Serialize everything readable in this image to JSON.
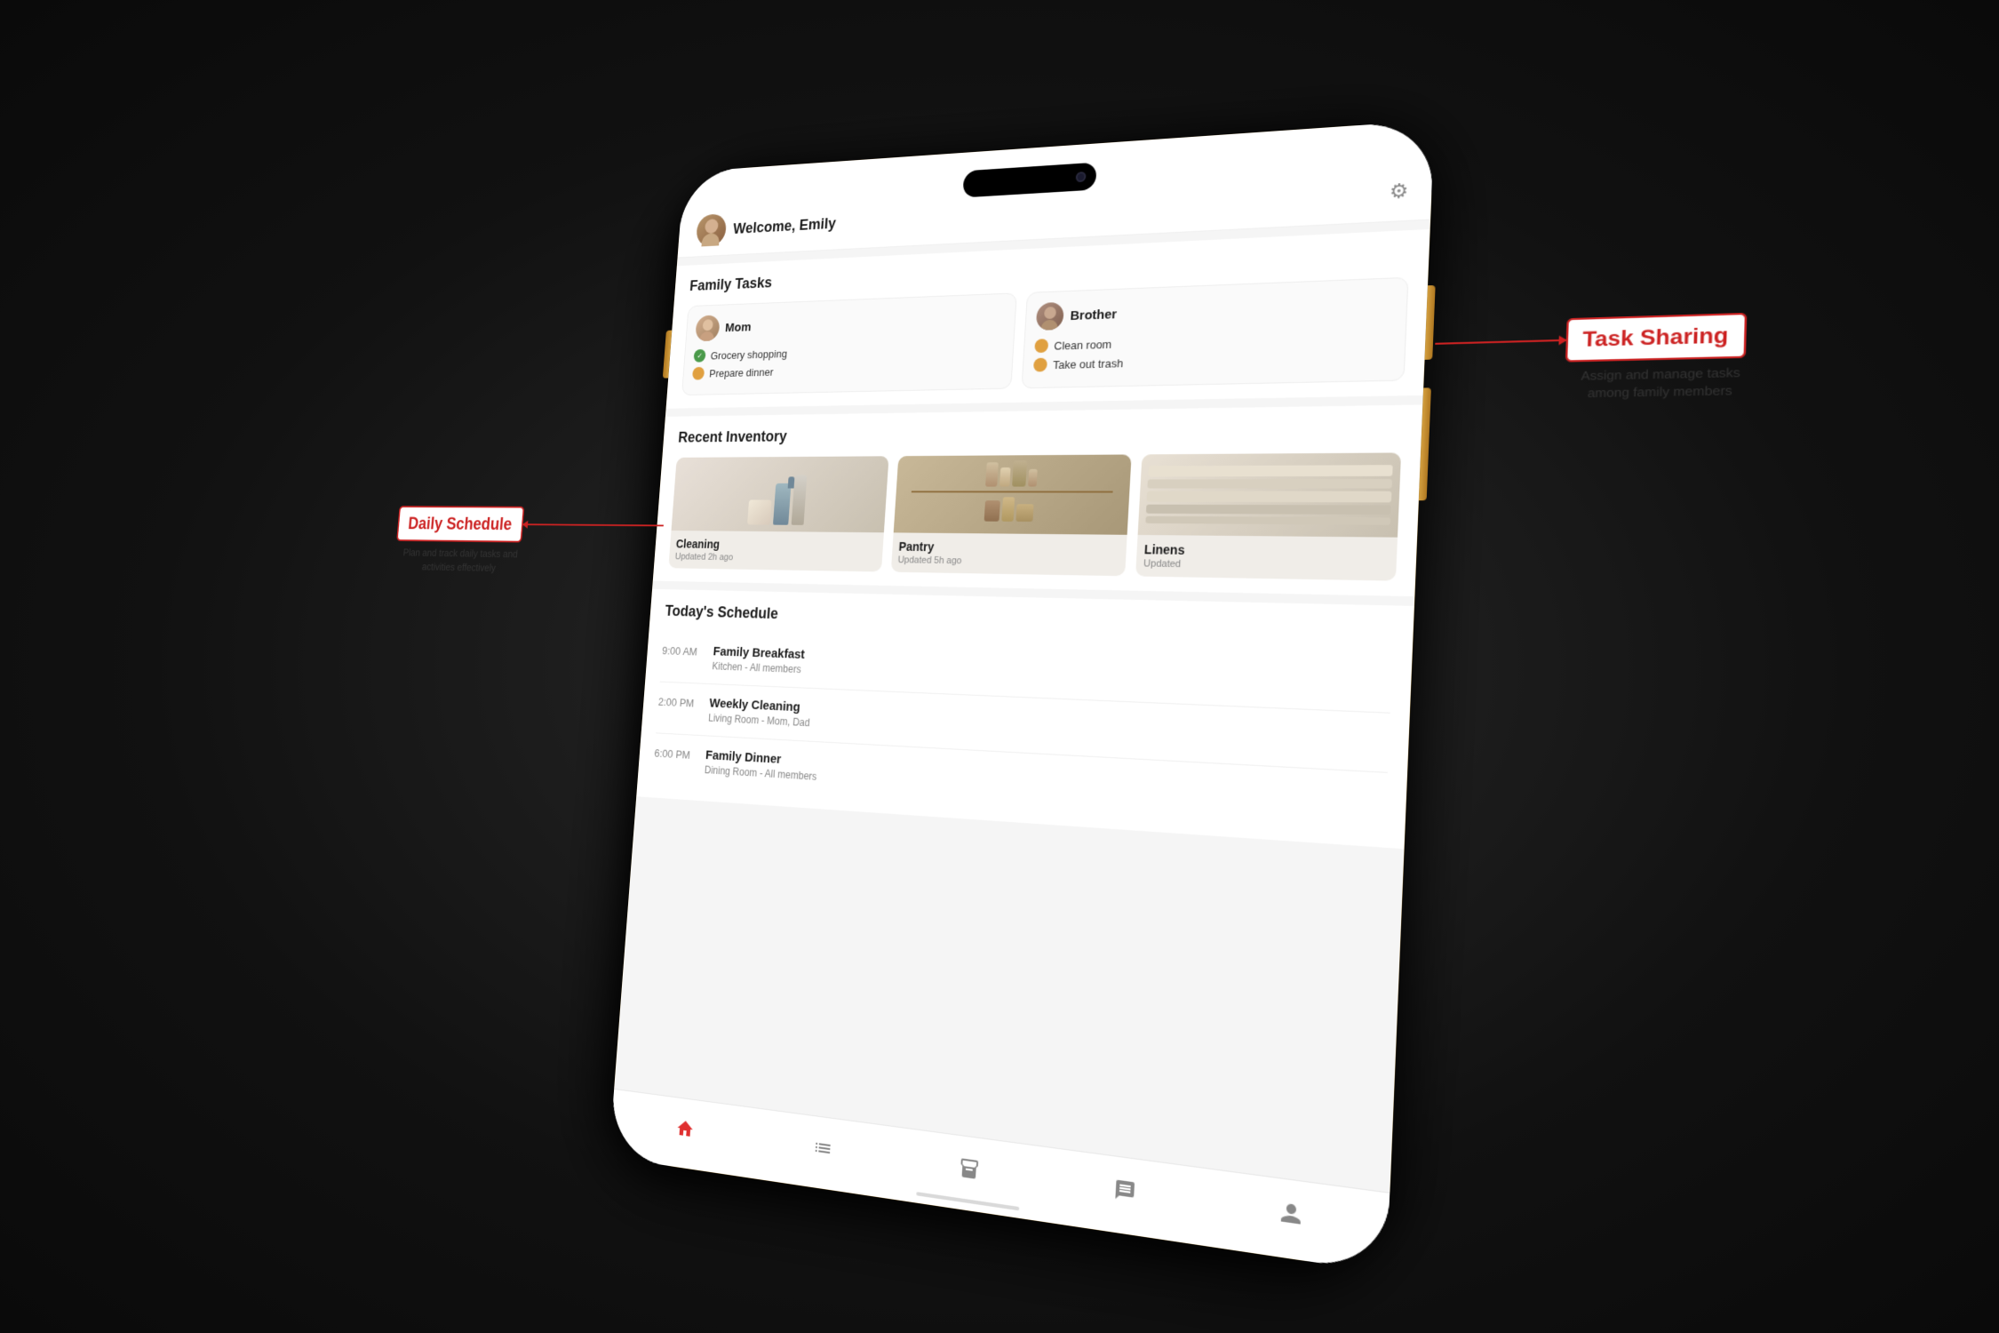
{
  "app": {
    "welcome": "Welcome, Emily",
    "settings_icon": "⚙"
  },
  "family_tasks": {
    "section_title": "Family Tasks",
    "members": [
      {
        "name": "Mom",
        "tasks": [
          {
            "label": "Grocery shopping",
            "status": "done"
          },
          {
            "label": "Prepare dinner",
            "status": "orange"
          }
        ]
      },
      {
        "name": "Brother",
        "tasks": [
          {
            "label": "Clean room",
            "status": "orange"
          },
          {
            "label": "Take out trash",
            "status": "orange"
          }
        ]
      }
    ]
  },
  "inventory": {
    "section_title": "Recent Inventory",
    "items": [
      {
        "name": "Cleaning",
        "update": "Updated 2h ago"
      },
      {
        "name": "Pantry",
        "update": "Updated 5h ago"
      },
      {
        "name": "Linens",
        "update": "Updated"
      }
    ]
  },
  "schedule": {
    "section_title": "Today's Schedule",
    "items": [
      {
        "time": "9:00 AM",
        "title": "Family Breakfast",
        "subtitle": "Kitchen - All members"
      },
      {
        "time": "2:00 PM",
        "title": "Weekly Cleaning",
        "subtitle": "Living Room - Mom, Dad"
      },
      {
        "time": "6:00 PM",
        "title": "Family Dinner",
        "subtitle": "Dining Room - All members"
      }
    ]
  },
  "callouts": {
    "task_sharing": {
      "title": "Task Sharing",
      "desc": "Assign and manage tasks among family members"
    },
    "daily_schedule": {
      "title": "Daily Schedule",
      "desc": "Plan and track daily tasks and activities effectively"
    }
  },
  "nav": {
    "items": [
      "home",
      "tasks",
      "inventory",
      "chat",
      "profile"
    ]
  }
}
